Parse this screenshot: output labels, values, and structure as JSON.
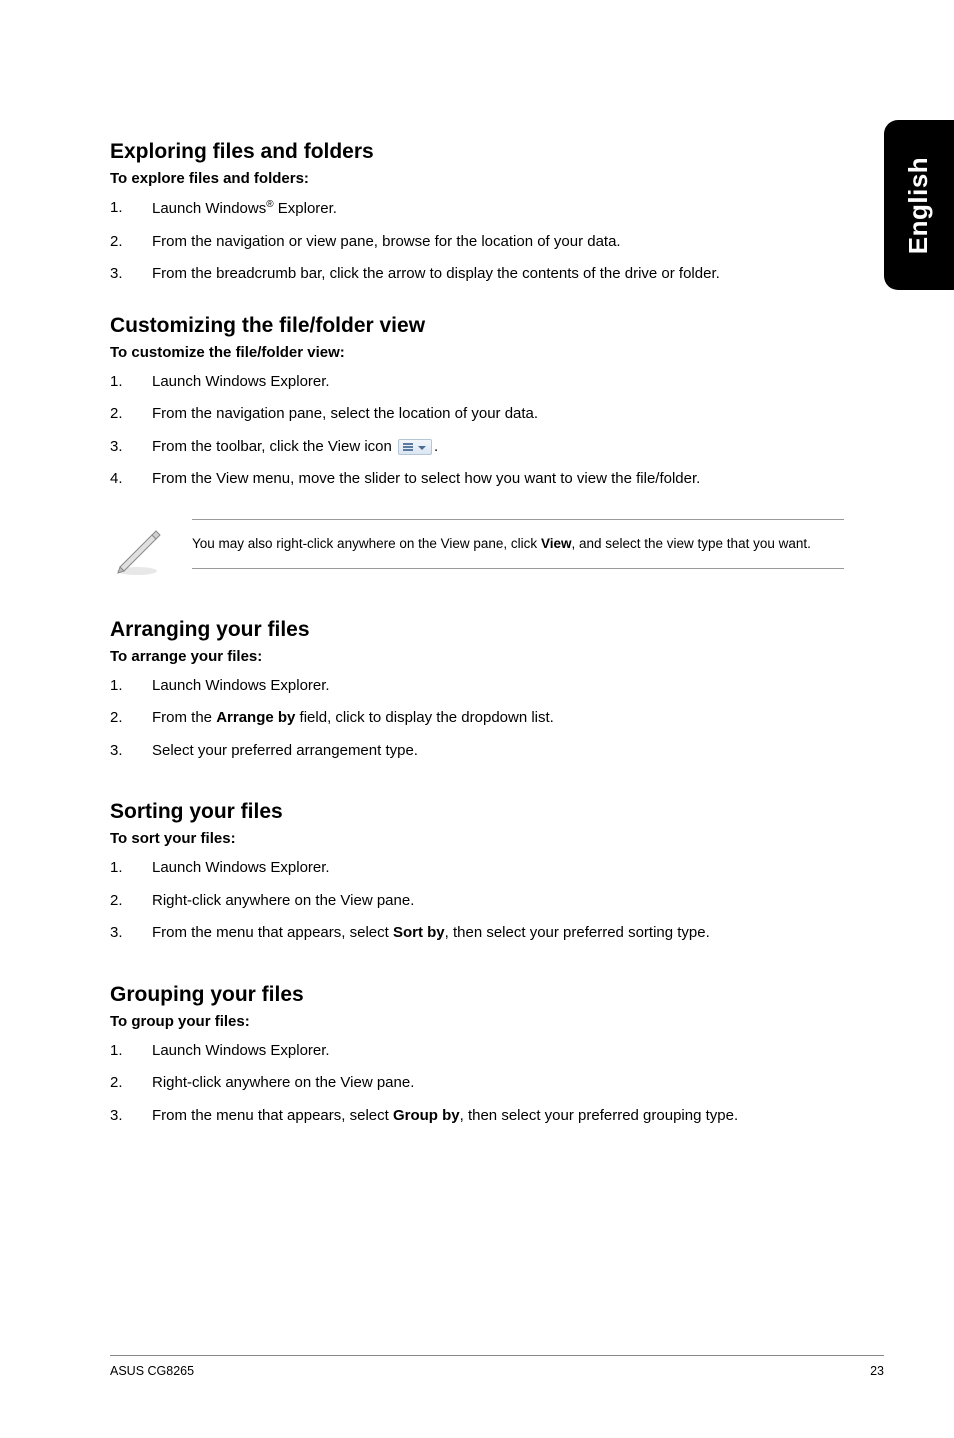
{
  "sideTab": "English",
  "sections": {
    "exploring": {
      "title": "Exploring files and folders",
      "subhead": "To explore files and folders:",
      "steps": [
        {
          "n": "1.",
          "pre": "Launch Windows",
          "sup": "®",
          "post": " Explorer."
        },
        {
          "n": "2.",
          "text": "From the navigation or view pane, browse for the location of your data."
        },
        {
          "n": "3.",
          "text": "From the breadcrumb bar, click the arrow to display the contents of the drive or folder."
        }
      ]
    },
    "customizing": {
      "title": "Customizing the file/folder view",
      "subhead": "To customize the file/folder view:",
      "steps": [
        {
          "n": "1.",
          "text": "Launch Windows Explorer."
        },
        {
          "n": "2.",
          "text": "From the navigation pane, select the location of your data."
        },
        {
          "n": "3.",
          "text_pre": "From the toolbar, click the View icon ",
          "has_icon": true,
          "text_post": "."
        },
        {
          "n": "4.",
          "text": "From the View menu, move the slider to select how you want to view the file/folder."
        }
      ],
      "note_pre": "You may also right-click anywhere on the View pane, click ",
      "note_bold": "View",
      "note_post": ", and select the view type that you want."
    },
    "arranging": {
      "title": "Arranging your files",
      "subhead": "To arrange your files:",
      "steps": [
        {
          "n": "1.",
          "text": "Launch Windows Explorer."
        },
        {
          "n": "2.",
          "text_pre": "From the ",
          "bold": "Arrange by",
          "text_post": " field, click to display the dropdown list."
        },
        {
          "n": "3.",
          "text": "Select your preferred arrangement type."
        }
      ]
    },
    "sorting": {
      "title": "Sorting your files",
      "subhead": "To sort your files:",
      "steps": [
        {
          "n": "1.",
          "text": "Launch Windows Explorer."
        },
        {
          "n": "2.",
          "text": "Right-click anywhere on the View pane."
        },
        {
          "n": "3.",
          "text_pre": "From the menu that appears, select ",
          "bold": "Sort by",
          "text_post": ", then select your preferred sorting type."
        }
      ]
    },
    "grouping": {
      "title": "Grouping your files",
      "subhead": "To group your files:",
      "steps": [
        {
          "n": "1.",
          "text": "Launch Windows Explorer."
        },
        {
          "n": "2.",
          "text": "Right-click anywhere on the View pane."
        },
        {
          "n": "3.",
          "text_pre": "From the menu that appears, select ",
          "bold": "Group by",
          "text_post": ", then select your preferred grouping type."
        }
      ]
    }
  },
  "footer": {
    "left": "ASUS CG8265",
    "right": "23"
  }
}
